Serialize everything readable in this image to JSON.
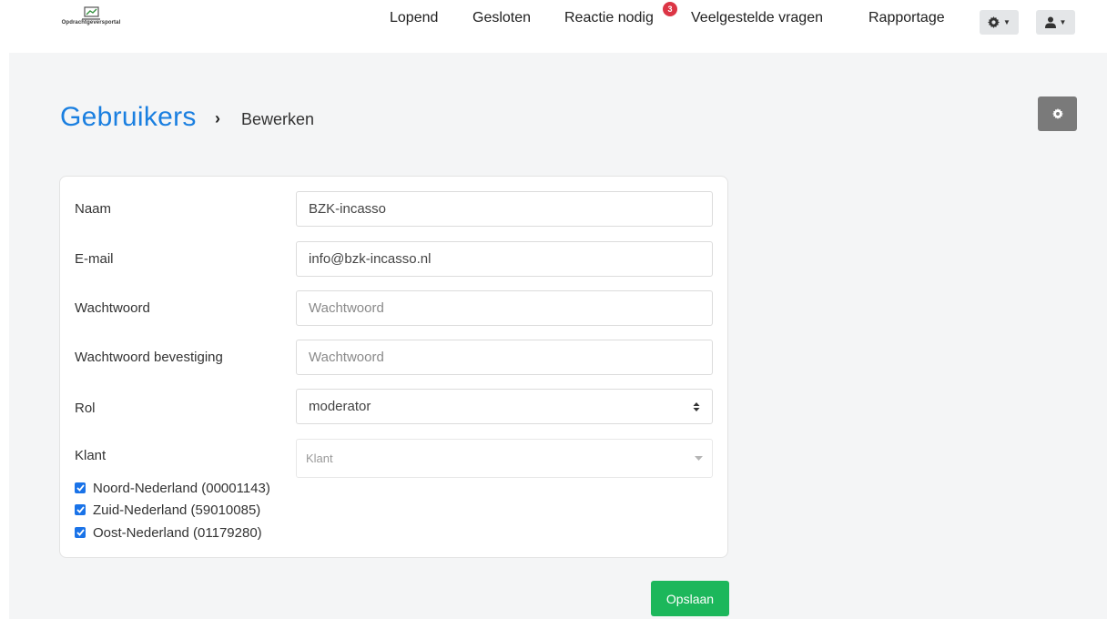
{
  "brand": {
    "name": "Opdrachtgeversportal"
  },
  "nav": {
    "links": [
      "Lopend",
      "Gesloten",
      "Reactie nodig",
      "Veelgestelde vragen",
      "Rapportage"
    ],
    "badge_count": "3",
    "settings_menu_icon": "gear-icon",
    "user_menu_icon": "user-icon"
  },
  "breadcrumb": {
    "parent": "Gebruikers",
    "separator": "›",
    "current": "Bewerken"
  },
  "form": {
    "naam": {
      "label": "Naam",
      "value": "BZK-incasso"
    },
    "email": {
      "label": "E-mail",
      "value": "info@bzk-incasso.nl"
    },
    "wachtwoord": {
      "label": "Wachtwoord",
      "placeholder": "Wachtwoord"
    },
    "wachtwoord_bevestiging": {
      "label": "Wachtwoord bevestiging",
      "placeholder": "Wachtwoord"
    },
    "rol": {
      "label": "Rol",
      "value": "moderator"
    },
    "klant": {
      "label": "Klant",
      "placeholder": "Klant",
      "options": [
        {
          "label": "Noord-Nederland (00001143)",
          "checked": true
        },
        {
          "label": "Zuid-Nederland (59010085)",
          "checked": true
        },
        {
          "label": "Oost-Nederland (01179280)",
          "checked": true
        }
      ]
    }
  },
  "save_label": "Opslaan",
  "colors": {
    "accent": "#1a7fe0",
    "save": "#1cb75b",
    "badge": "#dc3545",
    "checkbox": "#1a73e8"
  }
}
